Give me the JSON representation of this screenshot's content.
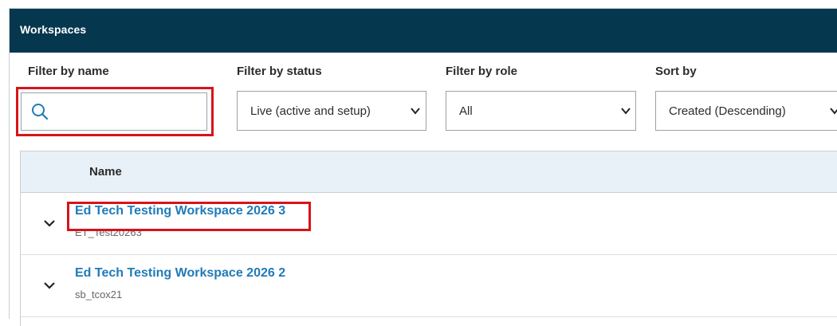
{
  "header": {
    "title": "Workspaces"
  },
  "filters": {
    "name": {
      "label": "Filter by name",
      "value": ""
    },
    "status": {
      "label": "Filter by status",
      "value": "Live (active and setup)"
    },
    "role": {
      "label": "Filter by role",
      "value": "All"
    },
    "sort": {
      "label": "Sort by",
      "value": "Created (Descending)"
    }
  },
  "table": {
    "columns": [
      "Name"
    ],
    "rows": [
      {
        "title": "Ed Tech Testing Workspace 2026 3",
        "code": "ET_Test20263"
      },
      {
        "title": "Ed Tech Testing Workspace 2026 2",
        "code": "sb_tcox21"
      }
    ]
  },
  "colors": {
    "header_bg": "#05384f",
    "link": "#1f7bb8",
    "highlight": "#d6141b",
    "table_head_bg": "#e9f1f8"
  },
  "icons": {
    "search": "search-icon",
    "dropdown": "chevron-down-icon",
    "expand": "chevron-down-icon"
  }
}
